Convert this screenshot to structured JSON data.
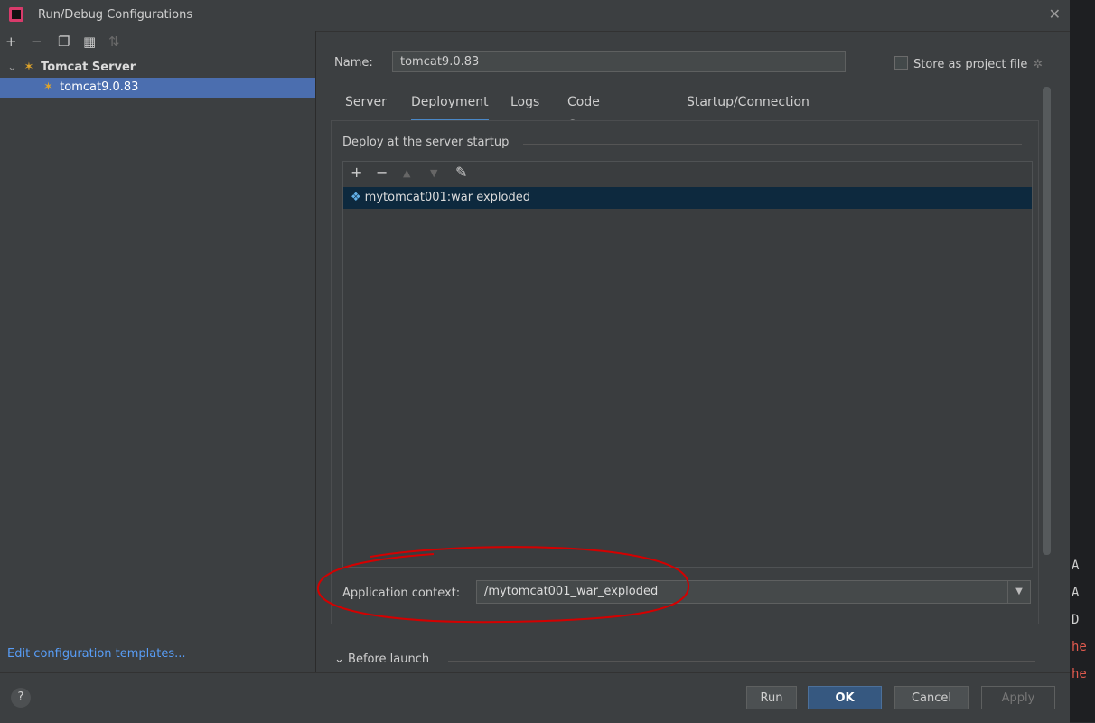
{
  "window": {
    "title": "Run/Debug Configurations",
    "close_glyph": "✕"
  },
  "left_toolbar": {
    "add": "+",
    "remove": "−",
    "copy": "❐",
    "folder": "▦",
    "sort": "⇅"
  },
  "tree": {
    "parent_label": "Tomcat Server",
    "child_label": "tomcat9.0.83"
  },
  "left_link": "Edit configuration templates...",
  "name_label": "Name:",
  "name_value": "tomcat9.0.83",
  "store_label": "Store as project file",
  "tabs": [
    "Server",
    "Deployment",
    "Logs",
    "Code Coverage",
    "Startup/Connection"
  ],
  "active_tab": "Deployment",
  "deploy": {
    "group_title": "Deploy at the server startup",
    "toolbar": {
      "add": "+",
      "remove": "−",
      "up": "▲",
      "down": "▼",
      "edit": "✎"
    },
    "items": [
      "mytomcat001:war exploded"
    ]
  },
  "context": {
    "label": "Application context:",
    "value": "/mytomcat001_war_exploded",
    "arrow": "▼"
  },
  "before_launch": {
    "chevron": "⌄",
    "label": "Before launch"
  },
  "footer": {
    "help": "?",
    "run": "Run",
    "ok": "OK",
    "cancel": "Cancel",
    "apply": "Apply"
  },
  "editor_strip": [
    "A",
    "A",
    "D",
    "he",
    "he"
  ],
  "colors": {
    "selection": "#4b6eaf",
    "deploy_selection": "#0d293e",
    "accent": "#4a88c7",
    "annotation": "#d40000"
  }
}
